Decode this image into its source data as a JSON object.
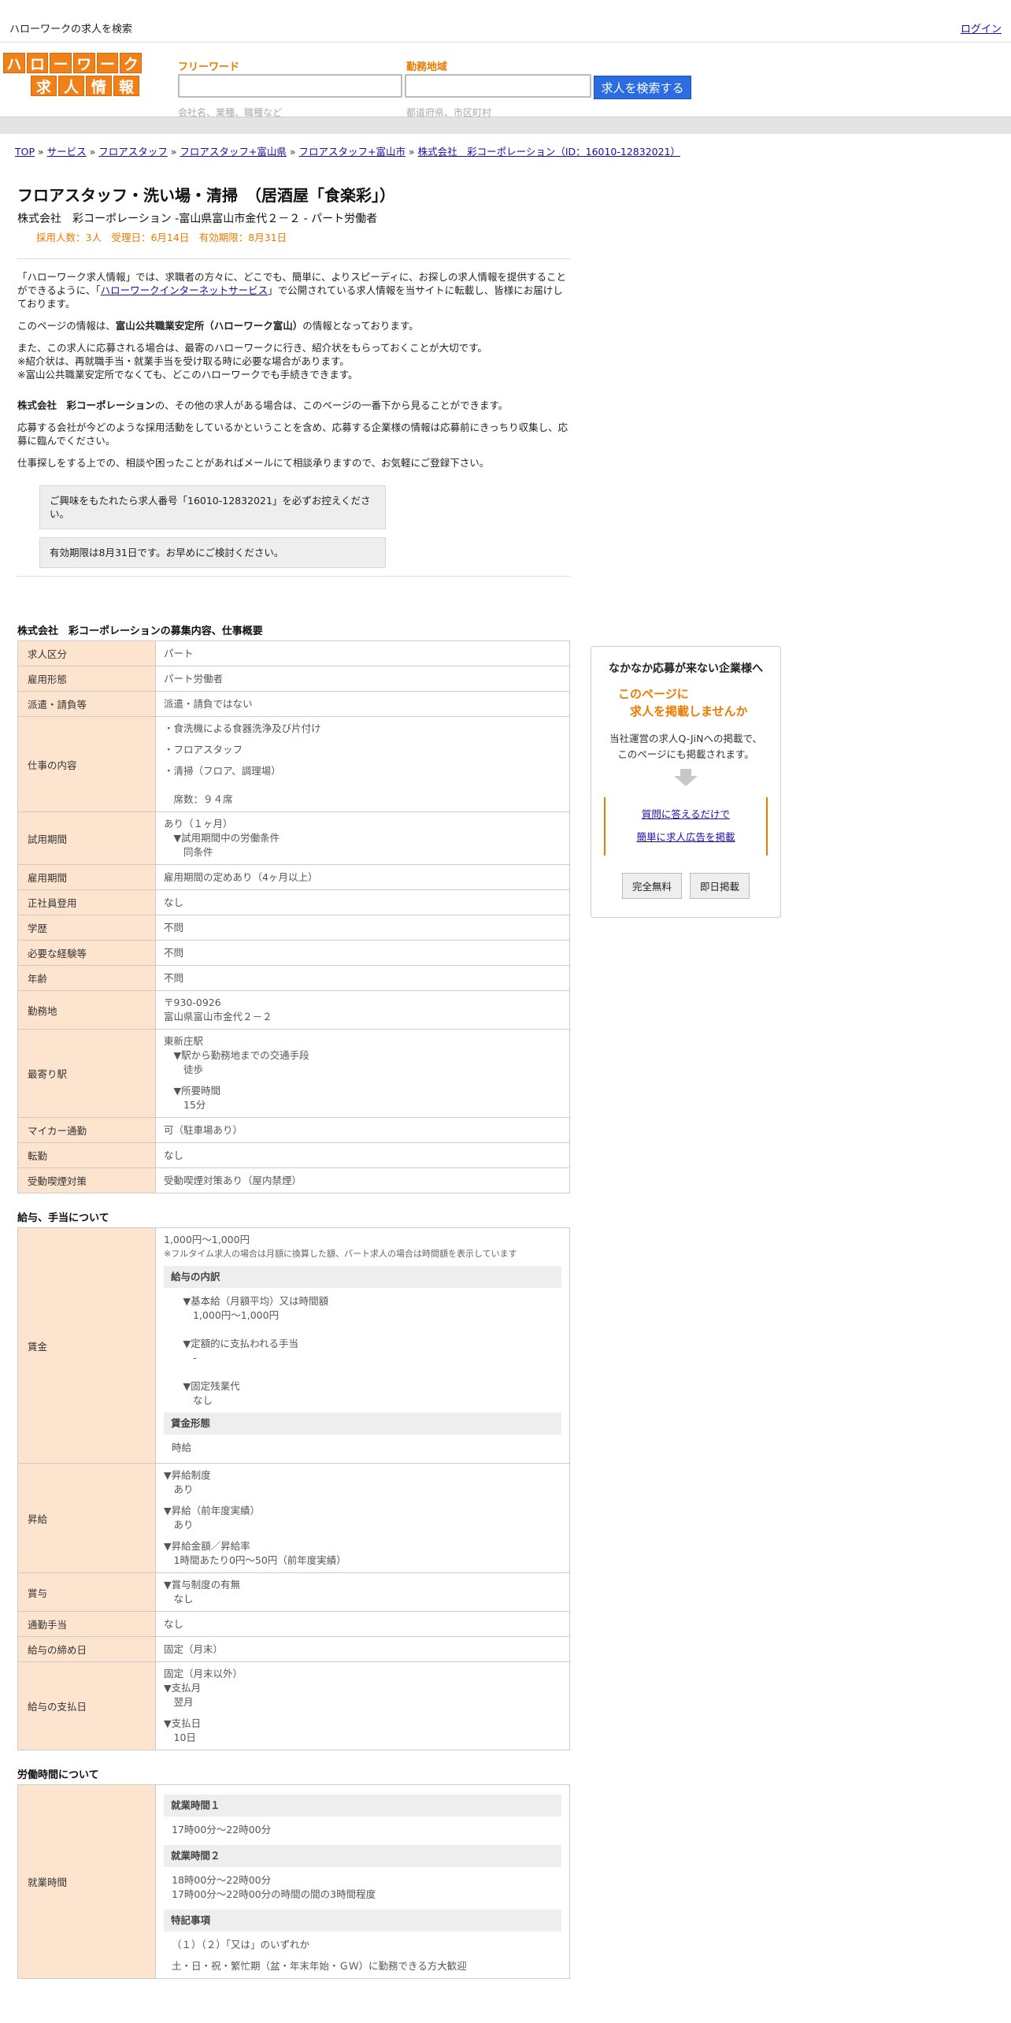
{
  "topbar": {
    "site_title": "ハローワークの求人を検索",
    "login": "ログイン"
  },
  "logo": {
    "row1": [
      "ハ",
      "ロ",
      "ー",
      "ワ",
      "ー",
      "ク"
    ],
    "row2": [
      "求",
      "人",
      "情",
      "報"
    ]
  },
  "search": {
    "freeword_label": "フリーワード",
    "freeword_hint": "会社名、業種、職種など",
    "area_label": "勤務地域",
    "area_hint": "都道府県、市区町村",
    "button": "求人を検索する"
  },
  "breadcrumb": {
    "items": [
      "TOP",
      "サービス",
      "フロアスタッフ",
      "フロアスタッフ+富山県",
      "フロアスタッフ+富山市",
      "株式会社　彩コーポレーション（ID：16010-12832021）"
    ],
    "sep": " » "
  },
  "job": {
    "title": "フロアスタッフ・洗い場・清掃　（居酒屋「食楽彩」）",
    "company_line": "株式会社　彩コーポレーション -富山県富山市金代２－２ - パート労働者",
    "meta": "採用人数：3人　受理日：6月14日　有効期限：8月31日"
  },
  "intro": {
    "p1_a": "「ハローワーク求人情報」では、求職者の方々に、どこでも、簡単に、よりスピーディに、お探しの求人情報を提供することができるように、「",
    "p1_link": "ハローワークインターネットサービス",
    "p1_b": "」で公開されている求人情報を当サイトに転載し、皆様にお届けしております。",
    "p2_a": "このページの情報は、",
    "p2_bold": "富山公共職業安定所（ハローワーク富山）",
    "p2_b": "の情報となっております。",
    "p3_1": "また、この求人に応募される場合は、最寄のハローワークに行き、紹介状をもらっておくことが大切です。",
    "p3_2": "※紹介状は、再就職手当・就業手当を受け取る時に必要な場合があります。",
    "p3_3": "※富山公共職業安定所でなくても、どこのハローワークでも手続きできます。",
    "p4_bold": "株式会社　彩コーポレーション",
    "p4_b": "の、その他の求人がある場合は、このページの一番下から見ることができます。",
    "p5": "応募する会社が今どのような採用活動をしているかということを含め、応募する企業様の情報は応募前にきっちり収集し、応募に臨んでください。",
    "p6": "仕事探しをする上での、相談や困ったことがあればメールにて相談承りますので、お気軽にご登録下さい。",
    "notice1": "ご興味をもたれたら求人番号「16010-12832021」を必ずお控えください。",
    "notice2": "有効期限は8月31日です。お早めにご検討ください。"
  },
  "overview": {
    "title": "株式会社　彩コーポレーションの募集内容、仕事概要",
    "rows": [
      {
        "label": "求人区分",
        "lines": [
          "パート"
        ]
      },
      {
        "label": "雇用形態",
        "lines": [
          "パート労働者"
        ]
      },
      {
        "label": "派遣・請負等",
        "lines": [
          "派遣・請負ではない"
        ]
      },
      {
        "label": "仕事の内容",
        "lines": [
          "・食洗機による食器洗浄及び片付け",
          "",
          "・フロアスタッフ",
          "",
          "・清掃（フロア、調理場）",
          "",
          "",
          "　席数：９４席"
        ]
      },
      {
        "label": "試用期間",
        "lines": [
          "あり（１ヶ月）",
          "　▼試用期間中の労働条件",
          "　　同条件"
        ]
      },
      {
        "label": "雇用期間",
        "lines": [
          "雇用期間の定めあり（4ヶ月以上）"
        ]
      },
      {
        "label": "正社員登用",
        "lines": [
          "なし"
        ]
      },
      {
        "label": "学歴",
        "lines": [
          "不問"
        ]
      },
      {
        "label": "必要な経験等",
        "lines": [
          "不問"
        ]
      },
      {
        "label": "年齢",
        "lines": [
          "不問"
        ]
      },
      {
        "label": "勤務地",
        "lines": [
          "〒930-0926",
          "富山県富山市金代２－２"
        ]
      },
      {
        "label": "最寄り駅",
        "lines": [
          "東新庄駅",
          "　▼駅から勤務地までの交通手段",
          "　　徒歩",
          "",
          "　▼所要時間",
          "　　15分"
        ]
      },
      {
        "label": "マイカー通勤",
        "lines": [
          "可（駐車場あり）"
        ]
      },
      {
        "label": "転勤",
        "lines": [
          "なし"
        ]
      },
      {
        "label": "受動喫煙対策",
        "lines": [
          "受動喫煙対策あり（屋内禁煙）"
        ]
      }
    ]
  },
  "salary": {
    "title": "給与、手当について",
    "wage_label": "賃金",
    "wage_range": "1,000円〜1,000円",
    "wage_note": "※フルタイム求人の場合は月額に換算した額、パート求人の場合は時間額を表示しています",
    "detail_heading": "給与の内訳",
    "detail_lines": [
      "▼基本給（月額平均）又は時間額",
      "　1,000円〜1,000円",
      "",
      "▼定額的に支払われる手当",
      "　-",
      "",
      "▼固定残業代",
      "　なし"
    ],
    "form_heading": "賃金形態",
    "form_value": "時給",
    "raise_label": "昇給",
    "raise_lines": [
      "▼昇給制度",
      "　あり",
      "",
      "▼昇給（前年度実績）",
      "　あり",
      "",
      "▼昇給金額／昇給率",
      "　1時間あたり0円〜50円（前年度実績）"
    ],
    "bonus_label": "賞与",
    "bonus_lines": [
      "▼賞与制度の有無",
      "　なし"
    ],
    "commute_label": "通勤手当",
    "commute_value": "なし",
    "closing_label": "給与の締め日",
    "closing_value": "固定（月末）",
    "payday_label": "給与の支払日",
    "payday_lines": [
      "固定（月末以外）",
      "▼支払月",
      "　翌月",
      "",
      "▼支払日",
      "　10日"
    ]
  },
  "hours": {
    "title": "労働時間について",
    "label": "就業時間",
    "h1_heading": "就業時間１",
    "h1_value": "17時00分〜22時00分",
    "h2_heading": "就業時間２",
    "h2_lines": [
      "18時00分〜22時00分",
      "17時00分〜22時00分の時間の間の3時間程度"
    ],
    "note_heading": "特記事項",
    "note_lines": [
      "（１）（２）「又は」のいずれか",
      "",
      "土・日・祝・繁忙期（盆・年末年始・ＧＷ）に勤務できる方大歓迎"
    ]
  },
  "sidebar": {
    "head": "なかなか応募が来ない企業様へ",
    "orange1": "このページに",
    "orange2": "　求人を掲載しませんか",
    "body1": "当社運営の求人Q-JiNへの掲載で、",
    "body2": "このページにも掲載されます。",
    "link1": "質問に答えるだけで",
    "link2": "簡単に求人広告を掲載",
    "btn1": "完全無料",
    "btn2": "即日掲載"
  }
}
